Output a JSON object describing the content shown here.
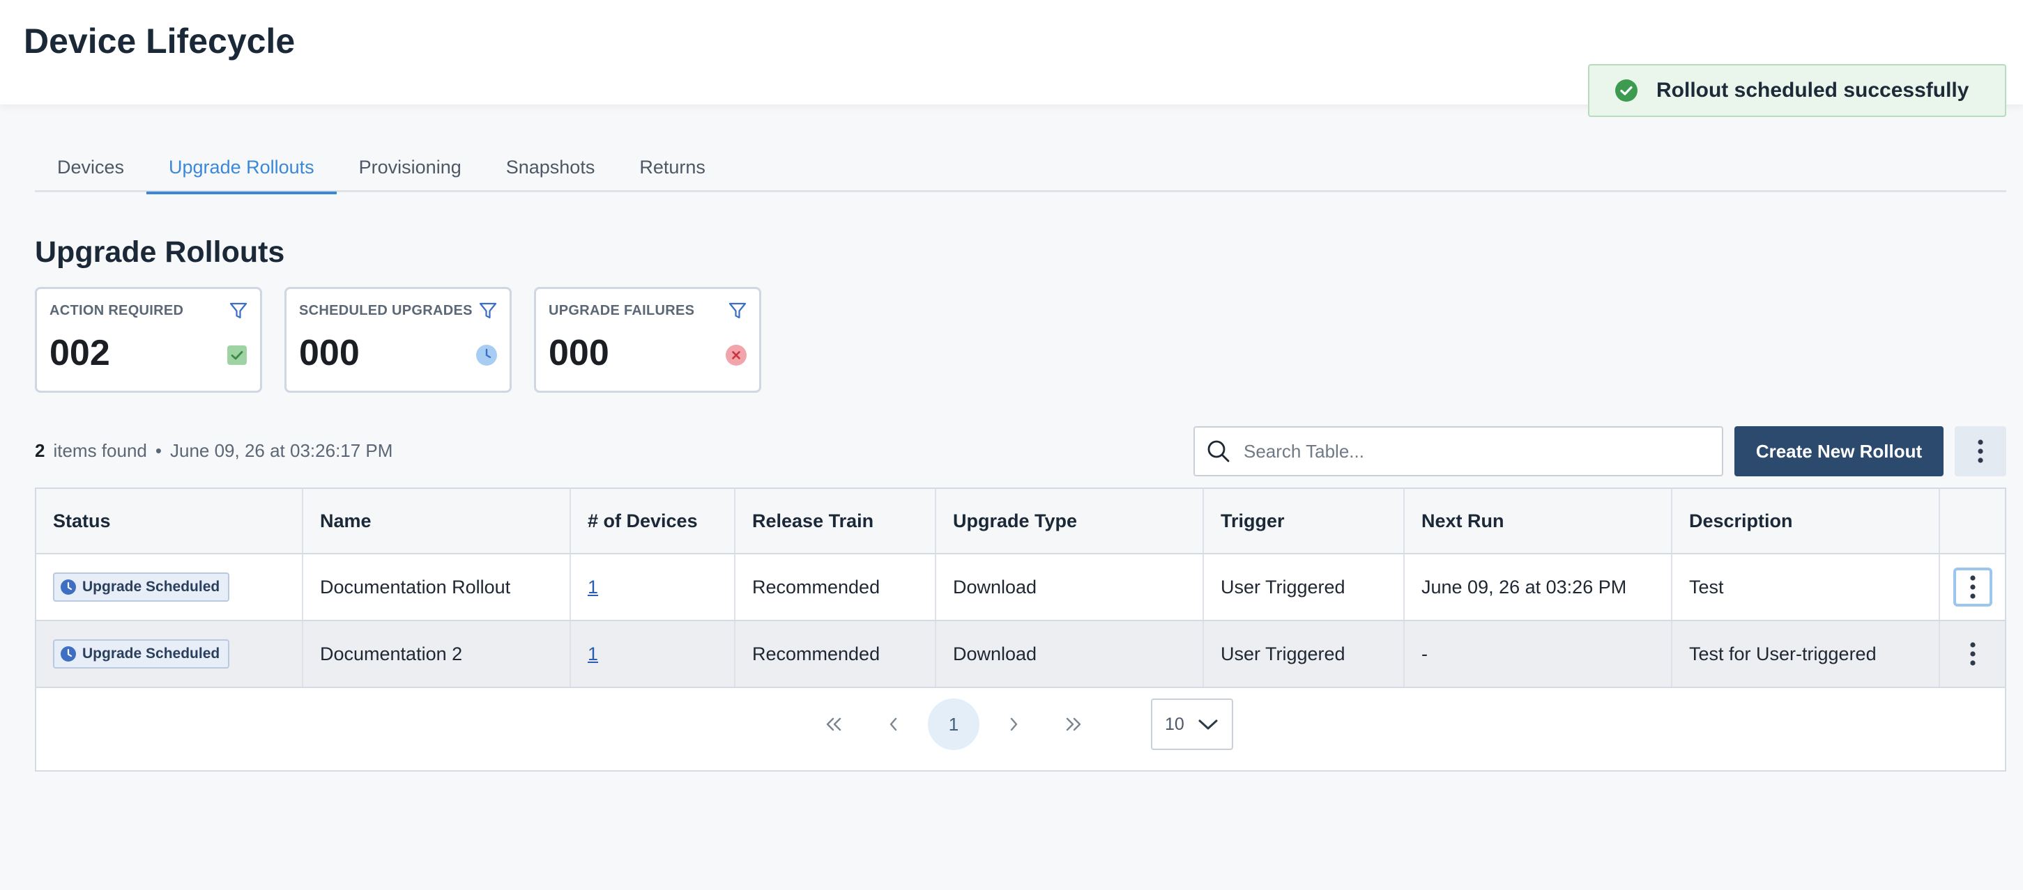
{
  "app": {
    "title": "Device Lifecycle"
  },
  "toast": {
    "message": "Rollout scheduled successfully"
  },
  "tabs": [
    {
      "label": "Devices",
      "active": false
    },
    {
      "label": "Upgrade Rollouts",
      "active": true
    },
    {
      "label": "Provisioning",
      "active": false
    },
    {
      "label": "Snapshots",
      "active": false
    },
    {
      "label": "Returns",
      "active": false
    }
  ],
  "section": {
    "title": "Upgrade Rollouts"
  },
  "cards": [
    {
      "label": "ACTION REQUIRED",
      "value": "002",
      "icon": "check-badge-icon",
      "color": "#7cc482"
    },
    {
      "label": "SCHEDULED UPGRADES",
      "value": "000",
      "icon": "clock-badge-icon",
      "color": "#8fbef0"
    },
    {
      "label": "UPGRADE FAILURES",
      "value": "000",
      "icon": "error-badge-icon",
      "color": "#e8838a"
    }
  ],
  "summary": {
    "count": "2",
    "label": "items found",
    "separator": "•",
    "timestamp": "June 09, 26 at 03:26:17 PM"
  },
  "search": {
    "placeholder": "Search Table..."
  },
  "actions": {
    "create_label": "Create New Rollout"
  },
  "table": {
    "columns": [
      "Status",
      "Name",
      "# of Devices",
      "Release Train",
      "Upgrade Type",
      "Trigger",
      "Next Run",
      "Description"
    ],
    "rows": [
      {
        "status": "Upgrade Scheduled",
        "name": "Documentation Rollout",
        "devices": "1",
        "release_train": "Recommended",
        "upgrade_type": "Download",
        "trigger": "User Triggered",
        "next_run": "June 09, 26 at 03:26 PM",
        "description": "Test"
      },
      {
        "status": "Upgrade Scheduled",
        "name": "Documentation 2",
        "devices": "1",
        "release_train": "Recommended",
        "upgrade_type": "Download",
        "trigger": "User Triggered",
        "next_run": "-",
        "description": "Test for User-triggered"
      }
    ]
  },
  "pagination": {
    "current_page": "1",
    "page_size": "10"
  },
  "colors": {
    "accent": "#3b87d9",
    "primary_button": "#2c4a6d",
    "success": "#3d9b4f"
  }
}
